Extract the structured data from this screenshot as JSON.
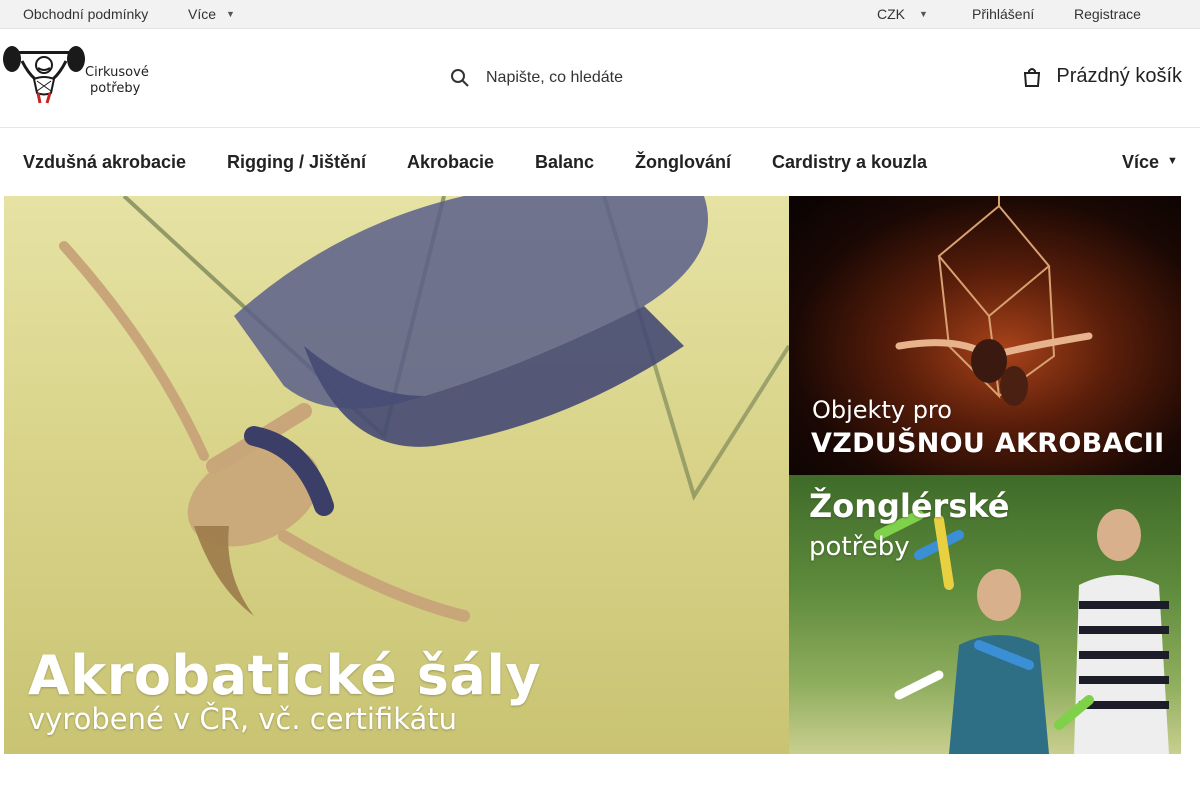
{
  "topbar": {
    "terms_link": "Obchodní podmínky",
    "more_label": "Více",
    "currency_label": "CZK",
    "login_link": "Přihlášení",
    "register_link": "Registrace",
    "chevron_icon": "chevron-down-icon"
  },
  "header": {
    "logo": {
      "line1": "Cirkusové",
      "line2": "potřeby",
      "icon": "strongman-logo"
    },
    "search": {
      "placeholder": "Napište, co hledáte",
      "icon": "search-icon"
    },
    "cart": {
      "label": "Prázdný košík",
      "icon": "cart-icon"
    }
  },
  "nav": {
    "items": [
      "Vzdušná akrobacie",
      "Rigging / Jištění",
      "Akrobacie",
      "Balanc",
      "Žonglování",
      "Cardistry a kouzla"
    ],
    "more_label": "Více"
  },
  "banners": {
    "main": {
      "title": "Akrobatické šály",
      "subtitle": "vyrobené v ČR, vč. certifikátu"
    },
    "aerial": {
      "line1": "Objekty pro",
      "line2": "VZDUŠNOU AKROBACII"
    },
    "juggling": {
      "line1": "Žonglérské",
      "line2": "potřeby"
    }
  },
  "colors": {
    "topbar_bg": "#f2f2f2",
    "text": "#222222",
    "logo_accent": "#cc2222"
  }
}
